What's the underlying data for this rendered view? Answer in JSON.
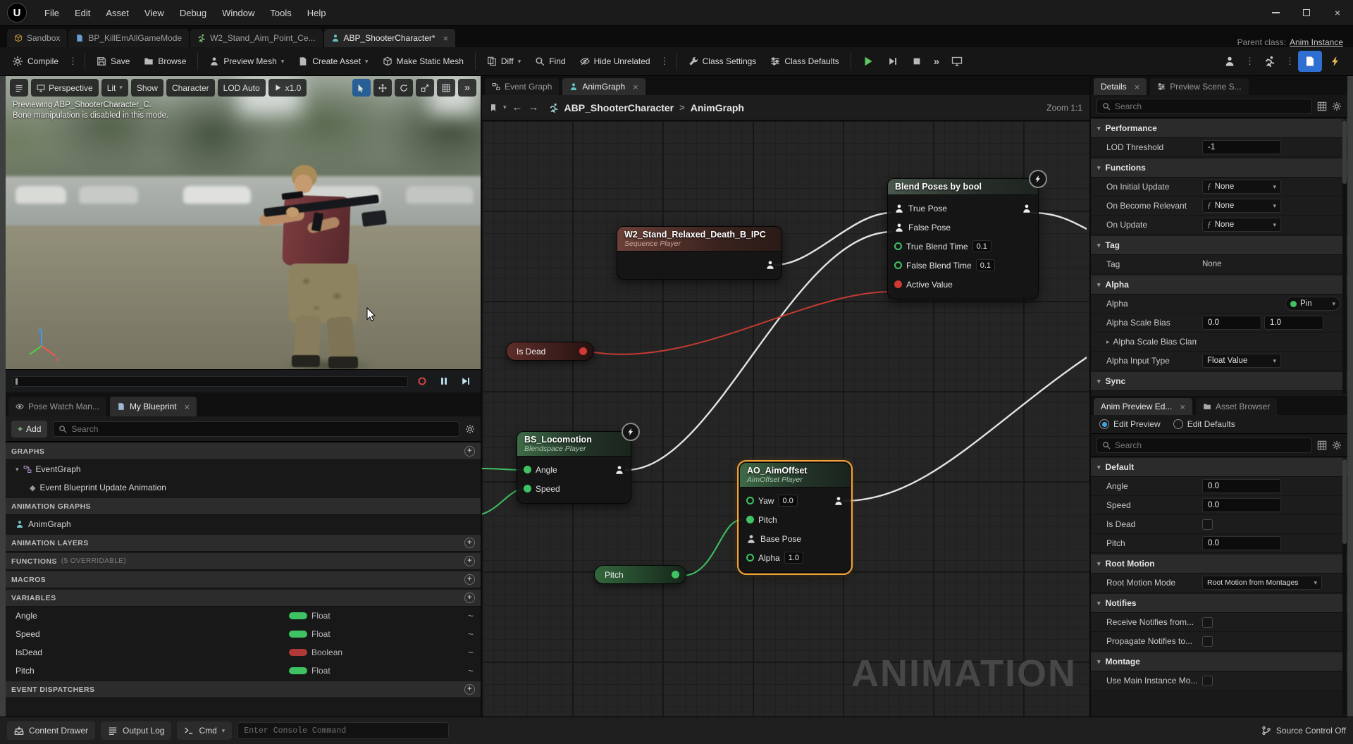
{
  "icons": {
    "ue_logo": "U",
    "caret_down": "▾",
    "caret_right": "▸",
    "ellipsis": "⋮",
    "chevrons": "»",
    "plus": "+",
    "fx": "ƒ",
    "event_diamond": "◆",
    "tilde": "~",
    "breadcrumb_separator": ">",
    "arrow_left": "←",
    "arrow_right": "→",
    "close": "×"
  },
  "colors": {
    "accent_blue": "#0070e0",
    "selection_orange": "#efa135",
    "pin_green": "#3fc264",
    "pin_red": "#cf3b30",
    "play_green": "#5fc75f"
  },
  "window": {
    "menus": [
      "File",
      "Edit",
      "Asset",
      "View",
      "Debug",
      "Window",
      "Tools",
      "Help"
    ],
    "parent_class_label": "Parent class:",
    "parent_class_value": "Anim Instance"
  },
  "asset_tabs": [
    {
      "label": "Sandbox"
    },
    {
      "label": "BP_KillEmAllGameMode"
    },
    {
      "label": "W2_Stand_Aim_Point_Ce..."
    },
    {
      "label": "ABP_ShooterCharacter*"
    }
  ],
  "toolbar": {
    "compile": "Compile",
    "save": "Save",
    "browse": "Browse",
    "preview_mesh": "Preview Mesh",
    "create_asset": "Create Asset",
    "make_static_mesh": "Make Static Mesh",
    "diff": "Diff",
    "find": "Find",
    "hide_unrelated": "Hide Unrelated",
    "class_settings": "Class Settings",
    "class_defaults": "Class Defaults"
  },
  "viewport": {
    "overlay_line1": "Previewing ABP_ShooterCharacter_C.",
    "overlay_line2": "Bone manipulation is disabled in this mode.",
    "toolbar": {
      "perspective": "Perspective",
      "lit": "Lit",
      "show": "Show",
      "character": "Character",
      "lod": "LOD Auto",
      "playback_speed": "x1.0"
    },
    "gizmo": {
      "z": "z",
      "x": "x"
    }
  },
  "my_blueprint": {
    "tab_pose_watch": "Pose Watch Man...",
    "tab_my_blueprint": "My Blueprint",
    "add_button": "Add",
    "search_placeholder": "Search",
    "graphs_header": "GRAPHS",
    "event_graph": "EventGraph",
    "event_update_anim": "Event Blueprint Update Animation",
    "animation_graphs_header": "ANIMATION GRAPHS",
    "anim_graph": "AnimGraph",
    "animation_layers_header": "ANIMATION LAYERS",
    "functions_header": "FUNCTIONS",
    "functions_badge": "(5 OVERRIDABLE)",
    "macros_header": "MACROS",
    "variables_header": "VARIABLES",
    "variables": [
      {
        "name": "Angle",
        "type": "Float"
      },
      {
        "name": "Speed",
        "type": "Float"
      },
      {
        "name": "IsDead",
        "type": "Boolean"
      },
      {
        "name": "Pitch",
        "type": "Float"
      }
    ],
    "event_dispatchers_header": "EVENT DISPATCHERS"
  },
  "graph": {
    "tab_event_graph": "Event Graph",
    "tab_anim_graph": "AnimGraph",
    "breadcrumb_root": "ABP_ShooterCharacter",
    "breadcrumb_current": "AnimGraph",
    "zoom": "Zoom 1:1",
    "watermark": "ANIMATION",
    "nodes": {
      "sequence": {
        "title": "W2_Stand_Relaxed_Death_B_IPC",
        "subtitle": "Sequence Player"
      },
      "blend": {
        "title": "Blend Poses by bool",
        "true_pose": "True Pose",
        "false_pose": "False Pose",
        "true_blend_time": "True Blend Time",
        "true_blend_value": "0.1",
        "false_blend_time": "False Blend Time",
        "false_blend_value": "0.1",
        "active_value": "Active Value"
      },
      "is_dead": {
        "label": "Is Dead"
      },
      "locomotion": {
        "title": "BS_Locomotion",
        "subtitle": "Blendspace Player",
        "pin_angle": "Angle",
        "pin_speed": "Speed"
      },
      "aim_offset": {
        "title": "AO_AimOffset",
        "subtitle": "AimOffset Player",
        "pin_yaw": "Yaw",
        "yaw_value": "0.0",
        "pin_pitch": "Pitch",
        "pin_base_pose": "Base Pose",
        "pin_alpha": "Alpha",
        "alpha_value": "1.0"
      },
      "pitch": {
        "label": "Pitch"
      }
    }
  },
  "details": {
    "tab_details": "Details",
    "tab_preview_scene": "Preview Scene S...",
    "search_placeholder": "Search",
    "performance_header": "Performance",
    "lod_threshold_label": "LOD Threshold",
    "lod_threshold_value": "-1",
    "functions_header": "Functions",
    "fn_rows": [
      {
        "label": "On Initial Update",
        "value": "None"
      },
      {
        "label": "On Become Relevant",
        "value": "None"
      },
      {
        "label": "On Update",
        "value": "None"
      }
    ],
    "tag_header": "Tag",
    "tag_label": "Tag",
    "tag_value": "None",
    "alpha_header": "Alpha",
    "alpha_label": "Alpha",
    "alpha_value": "Pin",
    "alpha_scale_bias_label": "Alpha Scale Bias",
    "alpha_scale_bias_min": "0.0",
    "alpha_scale_bias_max": "1.0",
    "alpha_scale_bias_clamp_label": "Alpha Scale Bias Clamp",
    "alpha_input_type_label": "Alpha Input Type",
    "alpha_input_type_value": "Float Value",
    "sync_header": "Sync"
  },
  "anim_preview": {
    "tab_anim_preview": "Anim Preview Ed...",
    "tab_asset_browser": "Asset Browser",
    "radio_edit_preview": "Edit Preview",
    "radio_edit_defaults": "Edit Defaults",
    "search_placeholder": "Search",
    "default_header": "Default",
    "rows": [
      {
        "label": "Angle",
        "value": "0.0"
      },
      {
        "label": "Speed",
        "value": "0.0"
      },
      {
        "label": "Is Dead",
        "value": ""
      },
      {
        "label": "Pitch",
        "value": "0.0"
      }
    ],
    "root_motion_header": "Root Motion",
    "root_motion_mode_label": "Root Motion Mode",
    "root_motion_mode_value": "Root Motion from Montages",
    "notifies_header": "Notifies",
    "receive_notifies_label": "Receive Notifies from...",
    "propagate_notifies_label": "Propagate Notifies to...",
    "montage_header": "Montage",
    "use_main_instance_label": "Use Main Instance Mo..."
  },
  "statusbar": {
    "content_drawer": "Content Drawer",
    "output_log": "Output Log",
    "cmd": "Cmd",
    "console_placeholder": "Enter Console Command",
    "source_control": "Source Control Off"
  }
}
